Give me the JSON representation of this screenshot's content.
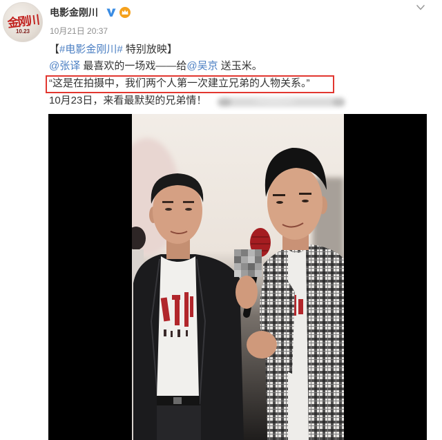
{
  "post": {
    "author": {
      "name": "电影金刚川",
      "verified": true,
      "avatar_logo_text": "金刚川",
      "avatar_logo_subtext": "10.23"
    },
    "timestamp": "10月21日 20:37",
    "line1": {
      "open": "【",
      "topic": "#电影金刚川#",
      "rest": " 特别放映】"
    },
    "line2": {
      "mention1": "@张译",
      "text1": " 最喜欢的一场戏——给",
      "mention2": "@吴京",
      "text2": " 送玉米。"
    },
    "line3": "“这是在拍摄中，我们两个人第一次建立兄弟的人物关系。”",
    "line4": "10月23日，来看最默契的兄弟情！"
  },
  "icons": {
    "verified": "verified-v-icon",
    "member_badge": "member-badge-icon",
    "menu": "chevron-down-icon"
  },
  "colors": {
    "text": "#333333",
    "meta": "#8e8e8e",
    "link": "#4b7fc3",
    "highlight_box": "#e2362f",
    "verified": "#3a8ce3",
    "member_badge": "#f5a11c",
    "avatar_logo": "#c1211e",
    "video_background": "#000000"
  }
}
